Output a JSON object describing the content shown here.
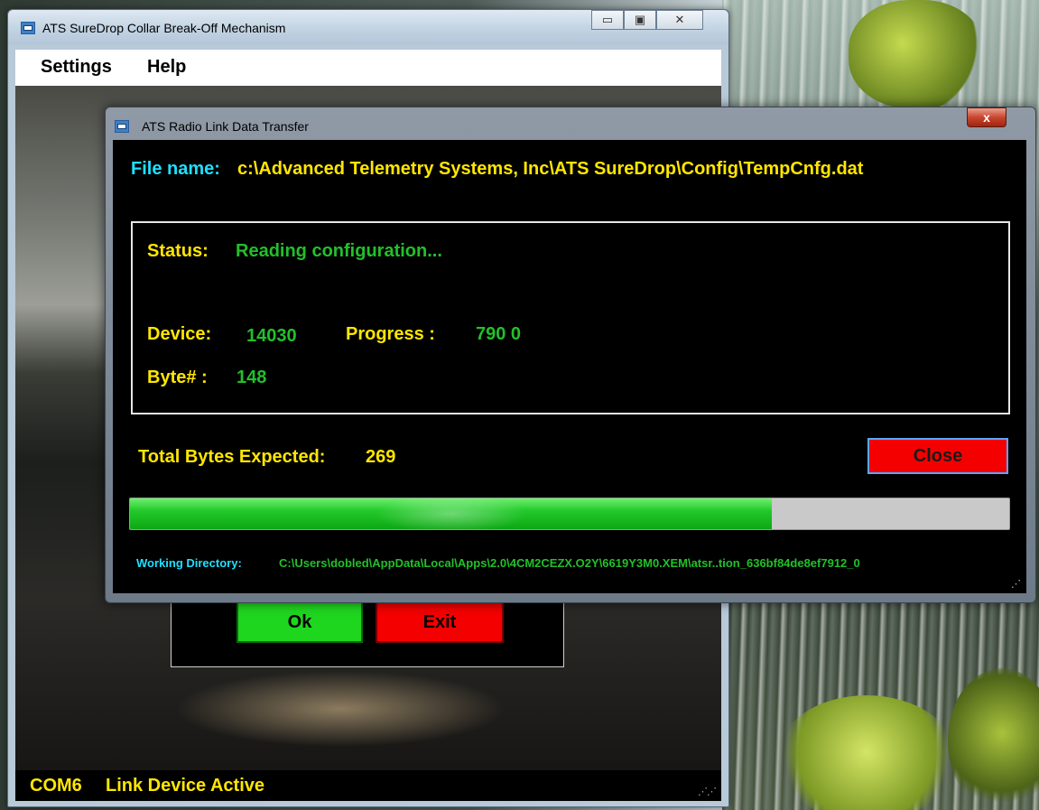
{
  "main_window": {
    "title": "ATS SureDrop Collar Break-Off Mechanism",
    "menu": [
      "Settings",
      "Help"
    ],
    "buttons": {
      "ok": "Ok",
      "exit": "Exit"
    },
    "caption_minimize": "▭",
    "caption_maximize": "▣",
    "caption_close": "✕",
    "status": {
      "port": "COM6",
      "link": "Link Device Active"
    }
  },
  "transfer_dialog": {
    "title": "ATS Radio Link Data Transfer",
    "close_glyph": "x",
    "file_name_label": "File name:",
    "file_name_value": "c:\\Advanced Telemetry Systems, Inc\\ATS SureDrop\\Config\\TempCnfg.dat",
    "status_label": "Status:",
    "status_value": "Reading configuration...",
    "device_label": "Device:",
    "device_value": "14030",
    "progress_label": "Progress :",
    "progress_value": "790 0",
    "byte_label": "Byte# :",
    "byte_value": "148",
    "total_label": "Total Bytes Expected:",
    "total_value": "269",
    "close_button": "Close",
    "progress_fraction": 0.73,
    "working_dir_label": "Working Directory:",
    "working_dir_value": "C:\\Users\\dobled\\AppData\\Local\\Apps\\2.0\\4CM2CEZX.O2Y\\6619Y3M0.XEM\\atsr..tion_636bf84de8ef7912_0"
  },
  "colors": {
    "label_yellow": "#ffe600",
    "value_green": "#22c02a",
    "label_cyan": "#1ee0ff",
    "close_red": "#f40000",
    "ok_green": "#1fd61f"
  }
}
